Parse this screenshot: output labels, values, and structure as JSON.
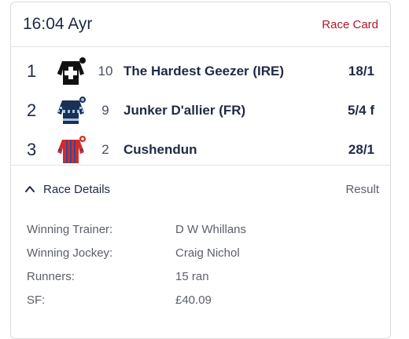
{
  "header": {
    "race_title": "16:04 Ayr",
    "race_card_link": "Race Card"
  },
  "runners": [
    {
      "position": "1",
      "cloth_number": "10",
      "horse": "The Hardest Geezer (IRE)",
      "odds": "18/1",
      "silk_icon": "silk-black-white-cross-icon"
    },
    {
      "position": "2",
      "cloth_number": "9",
      "horse": "Junker D'allier (FR)",
      "odds": "5/4 f",
      "silk_icon": "silk-navy-check-sleeves-icon"
    },
    {
      "position": "3",
      "cloth_number": "2",
      "horse": "Cushendun",
      "odds": "28/1",
      "silk_icon": "silk-red-blue-stripes-icon"
    }
  ],
  "details": {
    "toggle_label": "Race Details",
    "result_label": "Result",
    "rows": [
      {
        "label": "Winning Trainer:",
        "value": "D W Whillans"
      },
      {
        "label": "Winning Jockey:",
        "value": "Craig Nichol"
      },
      {
        "label": "Runners:",
        "value": "15 ran"
      },
      {
        "label": "SF:",
        "value": "£40.09"
      }
    ]
  },
  "colors": {
    "accent_red": "#b0182c",
    "text_navy": "#1f2a44",
    "muted_text": "#5c606a",
    "border": "#dcdcdc"
  }
}
